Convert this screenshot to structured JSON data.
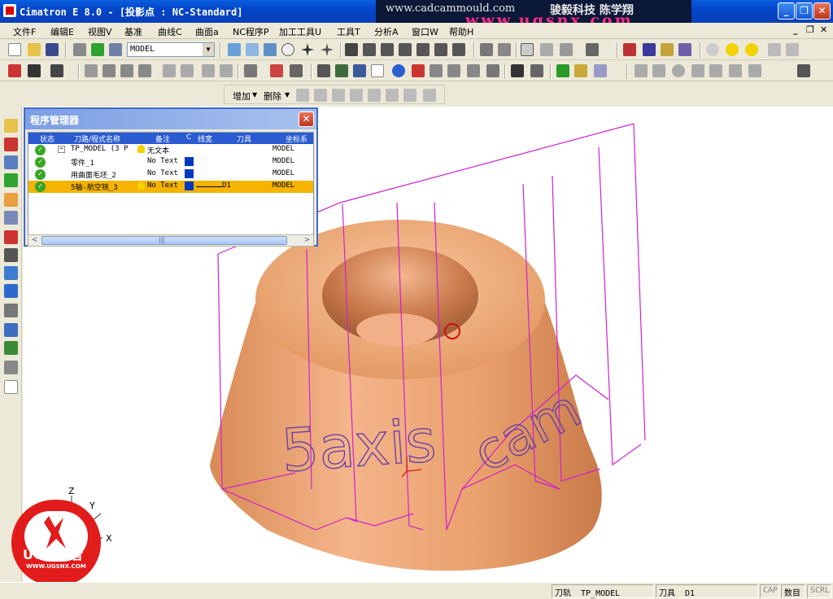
{
  "window": {
    "title": "Cimatron E 8.0 - [投影点 : NC-Standard]",
    "minimize_label": "_",
    "restore_label": "❐",
    "close_label": "✕"
  },
  "watermark": {
    "site": "www.cadcammould.com",
    "company": "骏毅科技  陈学翔",
    "site2": "www.ugsnx.com"
  },
  "menu": {
    "items": [
      "文件F",
      "编辑E",
      "视图V",
      "基准",
      "曲线C",
      "曲面a",
      "NC程序P",
      "加工工具U",
      "工具T",
      "分析A",
      "窗口W",
      "帮助H"
    ],
    "mdi_controls": [
      "_",
      "❐",
      "✕"
    ]
  },
  "toolbar": {
    "set_combo": "MODEL",
    "add_label": "增加",
    "delete_label": "删除"
  },
  "program_manager": {
    "title": "程序管理器",
    "close_label": "✕",
    "columns": [
      "状态",
      "刀路/程式名称",
      "备注",
      "C",
      "线宽",
      "刀具",
      "坐标系"
    ],
    "rows": [
      {
        "name": "TP_MODEL (3 P",
        "note": "无文本",
        "tool": "",
        "coord": "MODEL",
        "expand": "−"
      },
      {
        "name": "零件_1",
        "note": "No Text",
        "tool": "",
        "coord": "MODEL"
      },
      {
        "name": "用曲面毛坯_2",
        "note": "No Text",
        "tool": "",
        "coord": "MODEL"
      },
      {
        "name": "5轴-航空铣_3",
        "note": "No Text",
        "tool": "D1",
        "coord": "MODEL"
      }
    ],
    "scroll_left": "<",
    "scroll_right": ">",
    "scroll_grip": "|||"
  },
  "viewport": {
    "engraved_text": "5axis cam",
    "axes": [
      "Z",
      "Y",
      "X"
    ]
  },
  "status": {
    "toolpath_label": "刀轨",
    "toolpath_value": "TP_MODEL",
    "tool_label": "刀具",
    "tool_value": "D1",
    "cap": "CAP",
    "num": "数目",
    "scrl": "SCRL"
  },
  "logo": {
    "brand": "UG爱好者",
    "url": "WWW.UGSNX.COM"
  },
  "colors": {
    "part": "#e8a070",
    "toolpath": "#d020d0",
    "selection": "#f4b400",
    "titlebar": "#0246c9"
  }
}
